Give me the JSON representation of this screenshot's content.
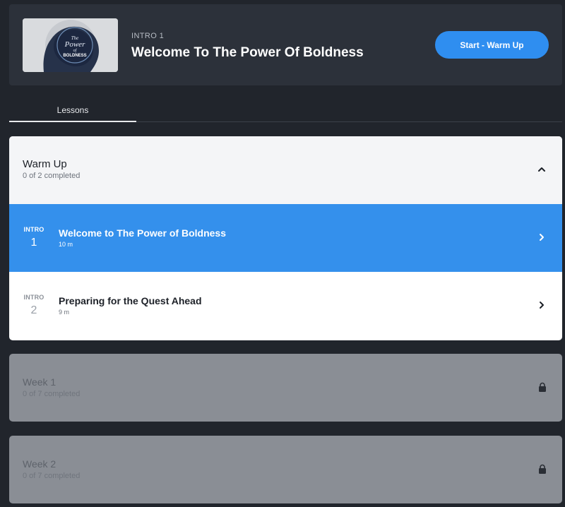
{
  "header": {
    "thumbnail_title_line1": "The",
    "thumbnail_title_line2": "Power",
    "thumbnail_title_line3": "of",
    "thumbnail_title_line4": "BOLDNESS",
    "intro_label": "INTRO 1",
    "title": "Welcome To The Power Of Boldness",
    "start_button": "Start - Warm Up"
  },
  "tabs": [
    {
      "label": "Lessons",
      "active": true
    }
  ],
  "sections": {
    "warm_up": {
      "title": "Warm Up",
      "progress": "0 of 2 completed",
      "expanded": true,
      "lessons": [
        {
          "tag": "INTRO",
          "number": "1",
          "title": "Welcome to The Power of Boldness",
          "duration": "10 m",
          "active": true
        },
        {
          "tag": "INTRO",
          "number": "2",
          "title": "Preparing for the Quest Ahead",
          "duration": "9 m",
          "active": false
        }
      ]
    },
    "week1": {
      "title": "Week 1",
      "progress": "0 of 7 completed",
      "locked": true
    },
    "week2": {
      "title": "Week 2",
      "progress": "0 of 7 completed",
      "locked": true
    }
  },
  "colors": {
    "background": "#21252c",
    "header_card": "#2c313a",
    "accent": "#2f8ef0",
    "active_lesson": "#3490ec",
    "locked_section": "#8a8e95"
  },
  "icons": {
    "expand_icon": "chevron-up-icon",
    "lesson_icon": "chevron-right-icon",
    "locked_icon": "lock-icon"
  }
}
